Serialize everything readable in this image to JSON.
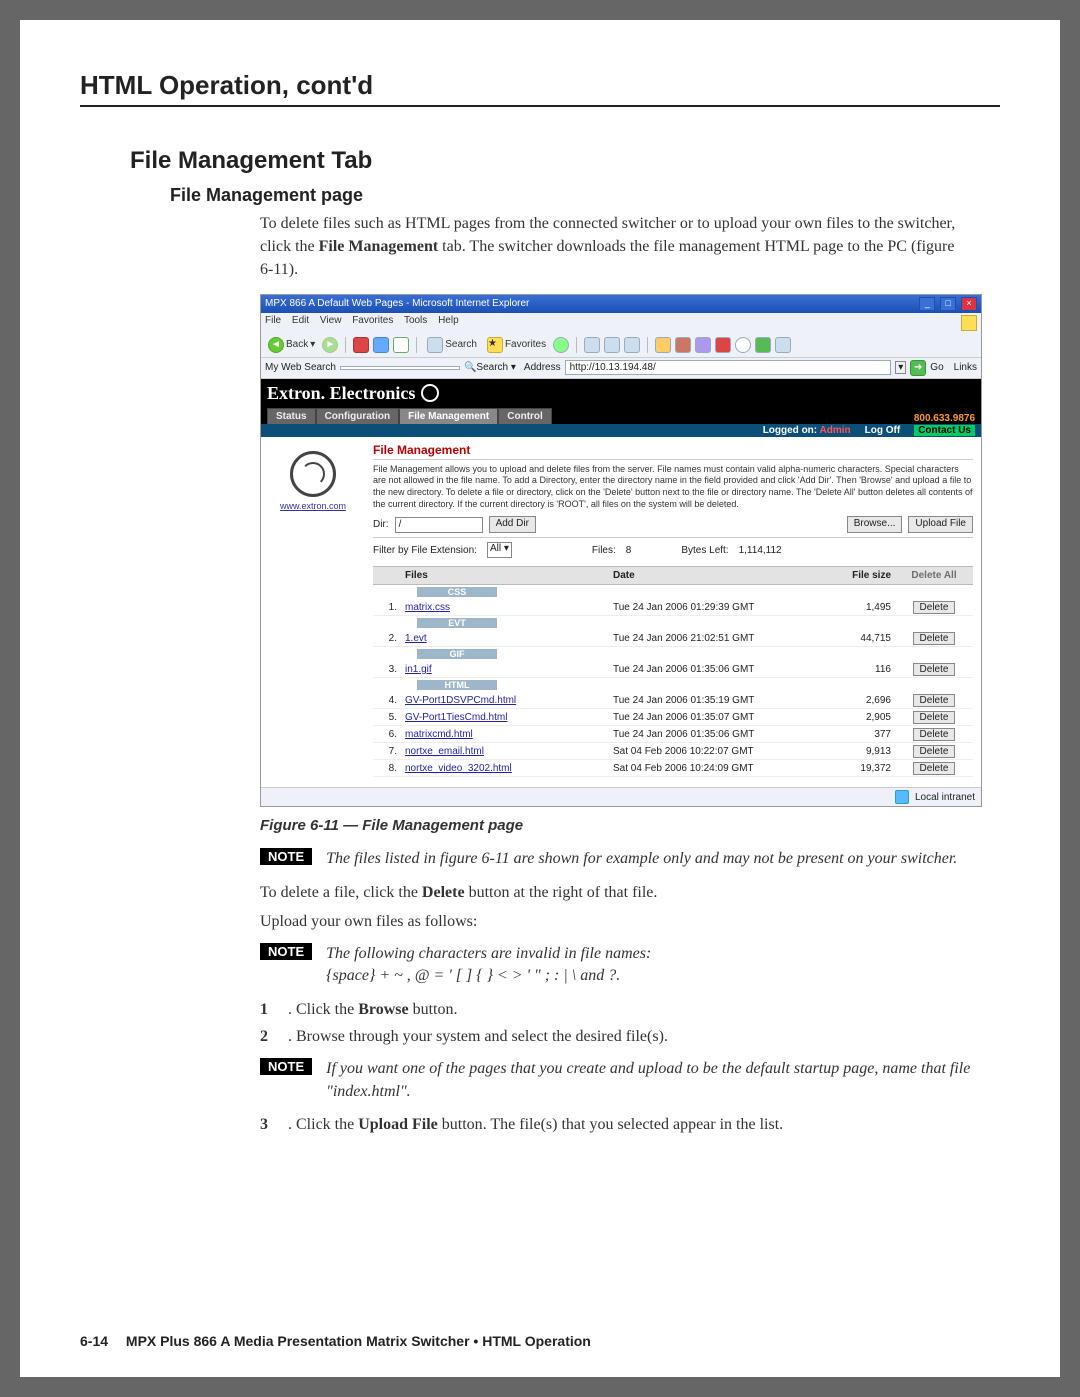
{
  "header": "HTML Operation, cont'd",
  "h1": "File Management Tab",
  "h2": "File Management page",
  "intro": {
    "pre": "To delete files such as HTML pages from the connected switcher or to upload your own files to the switcher, click the ",
    "bold": "File Management",
    "post": " tab.  The switcher downloads the file management HTML page to the PC (figure 6-11)."
  },
  "screenshot": {
    "title": "MPX 866 A Default Web Pages - Microsoft Internet Explorer",
    "menu": [
      "File",
      "Edit",
      "View",
      "Favorites",
      "Tools",
      "Help"
    ],
    "toolbar": {
      "back": "Back",
      "search": "Search",
      "favorites": "Favorites"
    },
    "addrbar": {
      "mywebsearch": "My Web Search",
      "searchbtn": "Search",
      "addresslbl": "Address",
      "url": "http://10.13.194.48/",
      "go": "Go",
      "links": "Links"
    },
    "brand": "Extron. Electronics",
    "tabs": [
      "Status",
      "Configuration",
      "File Management",
      "Control"
    ],
    "phone": "800.633.9876",
    "status": {
      "logged": "Logged on:",
      "admin": "Admin",
      "logoff": "Log Off",
      "contact": "Contact Us"
    },
    "leftlink": "www.extron.com",
    "fm": {
      "title": "File Management",
      "desc": "File Management allows you to upload and delete files from the server. File names must contain valid alpha-numeric characters. Special characters are not allowed in the file name. To add a Directory, enter the directory name in the field provided and click 'Add Dir'. Then 'Browse' and upload a file to the new directory. To delete a file or directory, click on the 'Delete' button next to the file or directory name. The 'Delete All' button deletes all contents of the current directory. If the current directory is 'ROOT', all files on the system will be deleted.",
      "dirlbl": "Dir:",
      "dirval": "/",
      "adddir": "Add Dir",
      "browse": "Browse...",
      "upload": "Upload File",
      "filterlbl": "Filter by File Extension:",
      "filterval": "All",
      "fileslbl": "Files:",
      "filesval": "8",
      "byteslbl": "Bytes Left:",
      "bytesval": "1,114,112",
      "cols": {
        "files": "Files",
        "date": "Date",
        "size": "File size",
        "deleteall": "Delete All"
      },
      "groups": [
        {
          "name": "CSS",
          "rows": [
            {
              "idx": "1.",
              "name": "matrix.css",
              "date": "Tue 24 Jan 2006 01:29:39 GMT",
              "size": "1,495"
            }
          ]
        },
        {
          "name": "EVT",
          "rows": [
            {
              "idx": "2.",
              "name": "1.evt",
              "date": "Tue 24 Jan 2006 21:02:51 GMT",
              "size": "44,715"
            }
          ]
        },
        {
          "name": "GIF",
          "rows": [
            {
              "idx": "3.",
              "name": "in1.gif",
              "date": "Tue 24 Jan 2006 01:35:06 GMT",
              "size": "116"
            }
          ]
        },
        {
          "name": "HTML",
          "rows": [
            {
              "idx": "4.",
              "name": "GV-Port1DSVPCmd.html",
              "date": "Tue 24 Jan 2006 01:35:19 GMT",
              "size": "2,696"
            },
            {
              "idx": "5.",
              "name": "GV-Port1TiesCmd.html",
              "date": "Tue 24 Jan 2006 01:35:07 GMT",
              "size": "2,905"
            },
            {
              "idx": "6.",
              "name": "matrixcmd.html",
              "date": "Tue 24 Jan 2006 01:35:06 GMT",
              "size": "377"
            },
            {
              "idx": "7.",
              "name": "nortxe_email.html",
              "date": "Sat 04 Feb 2006 10:22:07 GMT",
              "size": "9,913"
            },
            {
              "idx": "8.",
              "name": "nortxe_video_3202.html",
              "date": "Sat 04 Feb 2006 10:24:09 GMT",
              "size": "19,372"
            }
          ]
        }
      ],
      "delete": "Delete"
    },
    "statusbar": "Local intranet"
  },
  "caption": "Figure 6-11 — File Management page",
  "notes": {
    "badge": "NOTE",
    "n1": "The files listed in figure 6-11 are shown for example only and may not be present on your switcher.",
    "n2a": "The following characters are invalid in file names:",
    "n2b": "{space} + ~ , @ = ' [ ] { } < > ' \" ; : | \\ and ?.",
    "n3": "If you want one of the pages that you create and upload to be the default startup page, name that file \"index.html\"."
  },
  "paragraphs": {
    "p2a": "To delete a file, click the ",
    "p2b": "Delete",
    "p2c": " button at the right of that file.",
    "p3": "Upload your own files as follows:"
  },
  "steps": {
    "s1n": "1",
    "s1a": ". Click the ",
    "s1b": "Browse",
    "s1c": " button.",
    "s2n": "2",
    "s2": ". Browse through your system and select the desired file(s).",
    "s3n": "3",
    "s3a": ".   Click the ",
    "s3b": "Upload File",
    "s3c": " button.  The file(s) that you selected appear in the list."
  },
  "footer": {
    "pagenum": "6-14",
    "text": "MPX Plus 866 A Media Presentation Matrix Switcher • HTML Operation"
  }
}
